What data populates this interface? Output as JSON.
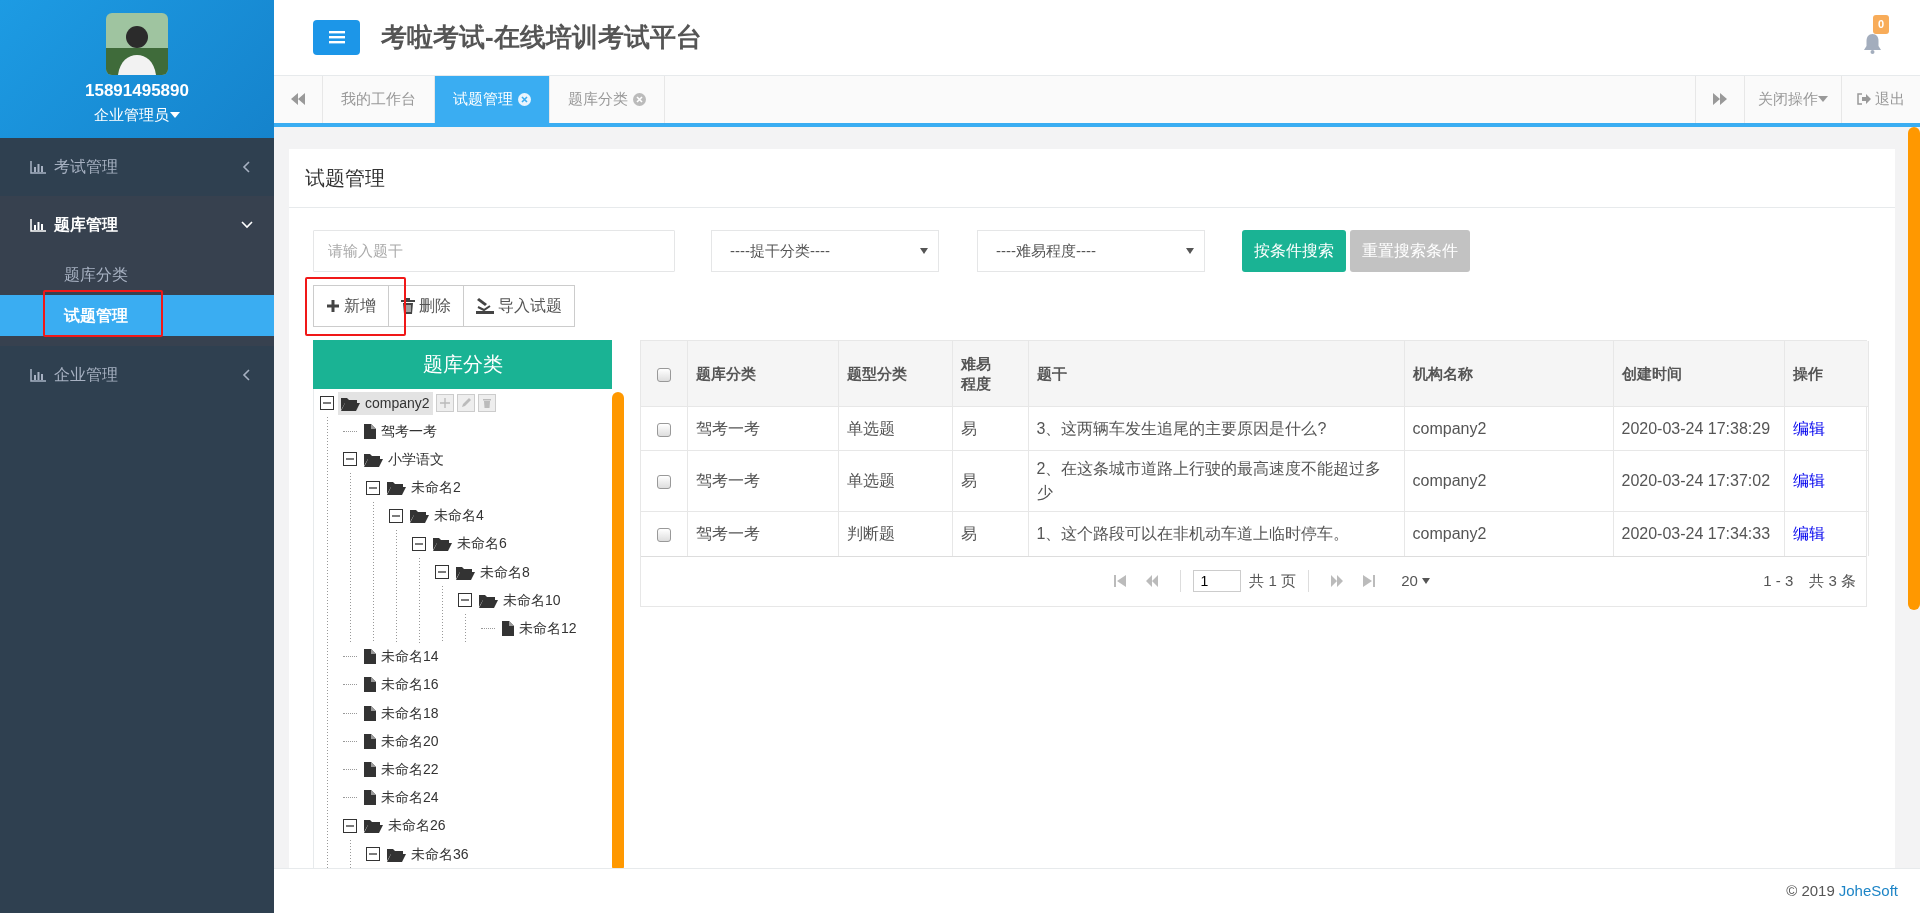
{
  "sidebar": {
    "user": {
      "name": "15891495890",
      "role": "企业管理员"
    },
    "menu": [
      {
        "label": "考试管理",
        "expanded": false
      },
      {
        "label": "题库管理",
        "expanded": true,
        "children": [
          {
            "label": "题库分类",
            "selected": false,
            "highlighted": false
          },
          {
            "label": "试题管理",
            "selected": true,
            "highlighted": true
          }
        ]
      },
      {
        "label": "企业管理",
        "expanded": false
      }
    ]
  },
  "header": {
    "title": "考啦考试-在线培训考试平台",
    "notifications": "0"
  },
  "tabs": {
    "items": [
      {
        "label": "我的工作台",
        "selected": false,
        "closable": false
      },
      {
        "label": "试题管理",
        "selected": true,
        "closable": true
      },
      {
        "label": "题库分类",
        "selected": false,
        "closable": true
      }
    ],
    "close_menu": "关闭操作",
    "logout": "退出"
  },
  "panel": {
    "title": "试题管理"
  },
  "search": {
    "placeholder": "请输入题干",
    "selects": [
      "----提干分类----",
      "----难易程度----"
    ],
    "buttons": [
      {
        "label": "按条件搜索",
        "kind": "primary"
      },
      {
        "label": "重置搜索条件",
        "kind": "secondary"
      }
    ]
  },
  "toolbar": [
    {
      "label": "新增",
      "kind": "add",
      "highlighted": true
    },
    {
      "label": "删除",
      "kind": "delete",
      "highlighted": false
    },
    {
      "label": "导入试题",
      "kind": "import",
      "highlighted": false
    }
  ],
  "tree": {
    "title": "题库分类",
    "nodes": [
      {
        "label": "company2",
        "kind": "folder",
        "expanded": true,
        "selected": true,
        "children": [
          {
            "label": "驾考一考",
            "kind": "file",
            "selected": false
          },
          {
            "label": "小学语文",
            "kind": "folder",
            "expanded": true,
            "selected": false,
            "children": [
              {
                "label": "未命名2",
                "kind": "folder",
                "expanded": true,
                "selected": false,
                "children": [
                  {
                    "label": "未命名4",
                    "kind": "folder",
                    "expanded": true,
                    "selected": false,
                    "children": [
                      {
                        "label": "未命名6",
                        "kind": "folder",
                        "expanded": true,
                        "selected": false,
                        "children": [
                          {
                            "label": "未命名8",
                            "kind": "folder",
                            "expanded": true,
                            "selected": false,
                            "children": [
                              {
                                "label": "未命名10",
                                "kind": "folder",
                                "expanded": true,
                                "selected": false,
                                "children": [
                                  {
                                    "label": "未命名12",
                                    "kind": "file",
                                    "selected": false
                                  }
                                ]
                              }
                            ]
                          }
                        ]
                      }
                    ]
                  }
                ]
              }
            ]
          },
          {
            "label": "未命名14",
            "kind": "file",
            "selected": false
          },
          {
            "label": "未命名16",
            "kind": "file",
            "selected": false
          },
          {
            "label": "未命名18",
            "kind": "file",
            "selected": false
          },
          {
            "label": "未命名20",
            "kind": "file",
            "selected": false
          },
          {
            "label": "未命名22",
            "kind": "file",
            "selected": false
          },
          {
            "label": "未命名24",
            "kind": "file",
            "selected": false
          },
          {
            "label": "未命名26",
            "kind": "folder",
            "expanded": true,
            "selected": false,
            "children": [
              {
                "label": "未命名36",
                "kind": "folder",
                "expanded": true,
                "selected": false
              }
            ]
          }
        ]
      }
    ]
  },
  "table": {
    "all_selected": false,
    "columns": [
      "题库分类",
      "题型分类",
      "难易程度",
      "题干",
      "机构名称",
      "创建时间",
      "操作"
    ],
    "rows": [
      {
        "selected": false,
        "cells": [
          "驾考一考",
          "单选题",
          "易",
          "3、这两辆车发生追尾的主要原因是什么?",
          "company2",
          "2020-03-24 17:38:29"
        ],
        "action": "编辑"
      },
      {
        "selected": false,
        "cells": [
          "驾考一考",
          "单选题",
          "易",
          "2、在这条城市道路上行驶的最高速度不能超过多少",
          "company2",
          "2020-03-24 17:37:02"
        ],
        "action": "编辑"
      },
      {
        "selected": false,
        "cells": [
          "驾考一考",
          "判断题",
          "易",
          "1、这个路段可以在非机动车道上临时停车。",
          "company2",
          "2020-03-24 17:34:33"
        ],
        "action": "编辑"
      }
    ],
    "pagination": {
      "page": "1",
      "total_pages": "共 1 页",
      "page_size": "20",
      "range": "1 - 3",
      "total": "共 3 条"
    }
  },
  "footer": {
    "copyright": "© 2019",
    "link": "JoheSoft"
  }
}
